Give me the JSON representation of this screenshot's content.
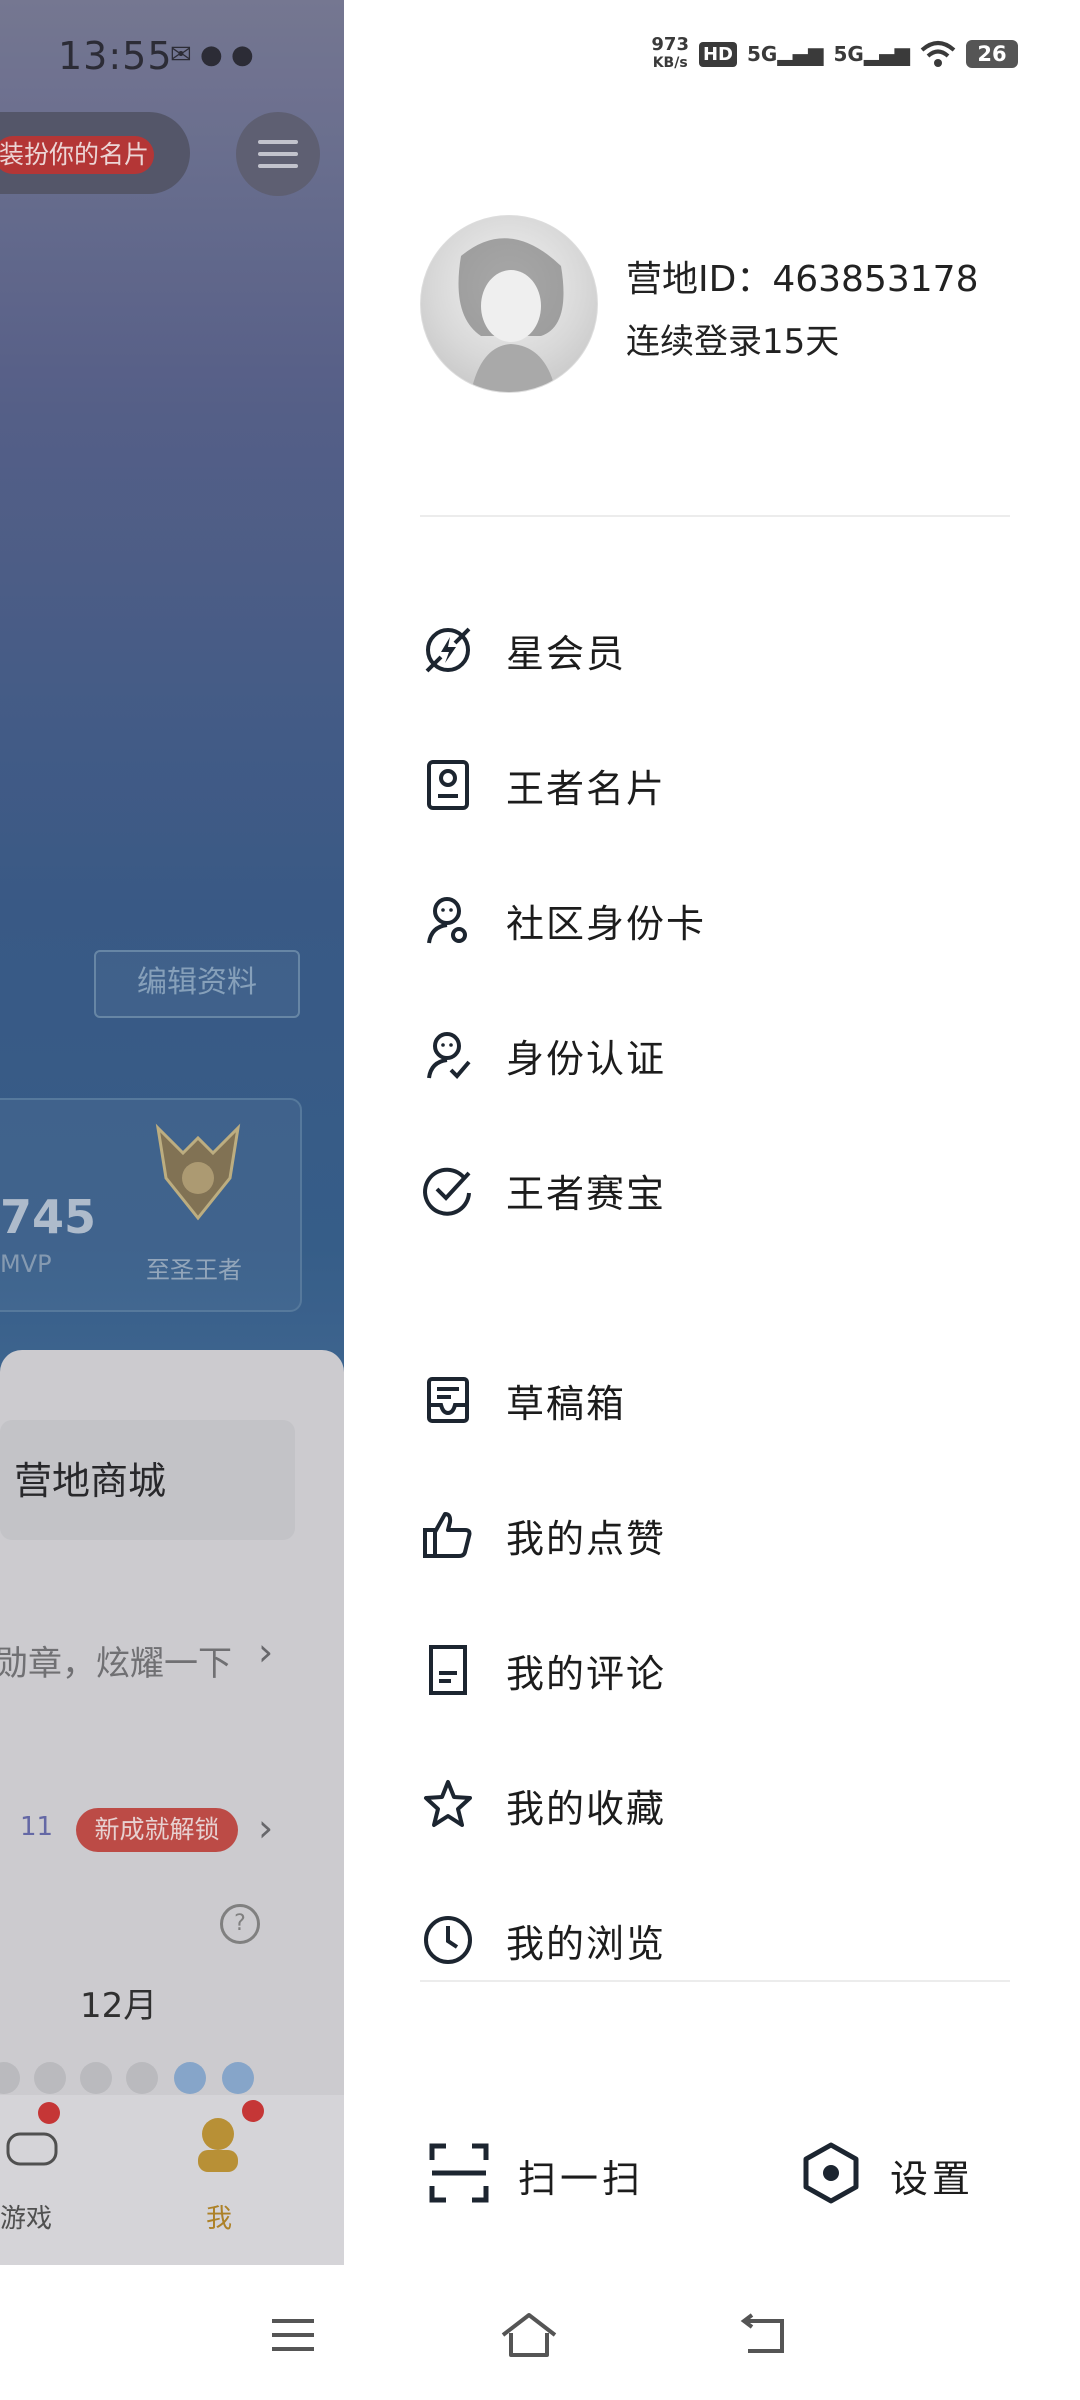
{
  "background_page": {
    "time": "13:55",
    "dress_up_badge": "装扮你的名片",
    "edit_profile_button": "编辑资料",
    "stat_number": "745",
    "stat_label": "MVP",
    "rank_name": "至圣王者",
    "shop_label": "营地商城",
    "medal_text": "勋章，炫耀一下",
    "badge_count": "11",
    "new_unlock_badge": "新成就解锁",
    "month_label": "12月",
    "tabs": [
      {
        "label": "游戏"
      },
      {
        "label": "我"
      }
    ]
  },
  "status_bar": {
    "net_speed_value": "973",
    "net_speed_unit": "KB/s",
    "hd_label": "HD",
    "sim1": "5G",
    "sim2": "5G",
    "battery": "26"
  },
  "drawer": {
    "profile": {
      "camp_id_text": "营地ID：463853178",
      "login_streak": "连续登录15天"
    },
    "menu_group_1": [
      {
        "label": "星会员",
        "icon": "star-member-icon"
      },
      {
        "label": "王者名片",
        "icon": "card-icon"
      },
      {
        "label": "社区身份卡",
        "icon": "community-id-icon"
      },
      {
        "label": "身份认证",
        "icon": "verify-identity-icon"
      },
      {
        "label": "王者赛宝",
        "icon": "check-badge-icon"
      }
    ],
    "menu_group_2": [
      {
        "label": "草稿箱",
        "icon": "draft-box-icon"
      },
      {
        "label": "我的点赞",
        "icon": "thumbs-up-icon"
      },
      {
        "label": "我的评论",
        "icon": "comment-doc-icon"
      },
      {
        "label": "我的收藏",
        "icon": "star-icon"
      },
      {
        "label": "我的浏览",
        "icon": "clock-icon"
      }
    ],
    "bottom": {
      "scan_label": "扫一扫",
      "settings_label": "设置"
    }
  },
  "colors": {
    "drawer_bg": "#ffffff",
    "text_primary": "#1c1c1c",
    "icon_stroke": "#1c2530",
    "badge_red": "#c8504b"
  }
}
